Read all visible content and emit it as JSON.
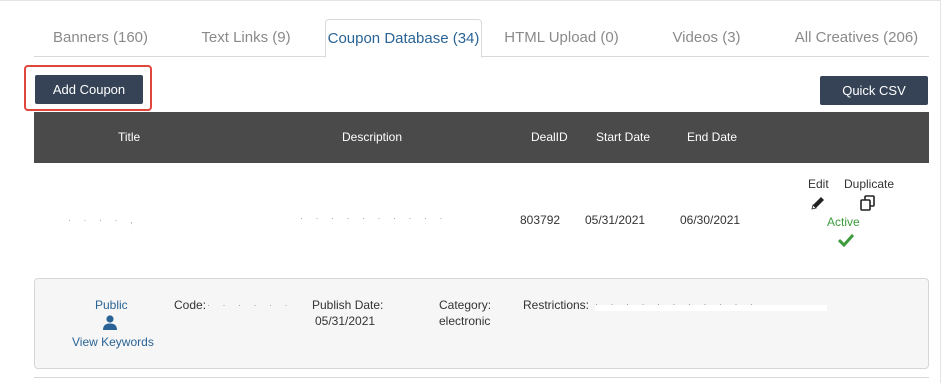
{
  "tabs": [
    {
      "label": "Banners (160)"
    },
    {
      "label": "Text Links (9)"
    },
    {
      "label": "Coupon Database (34)"
    },
    {
      "label": "HTML Upload (0)"
    },
    {
      "label": "Videos (3)"
    },
    {
      "label": "All Creatives (206)"
    }
  ],
  "active_tab": "Coupon Database (34)",
  "toolbar": {
    "add_label": "Add Coupon",
    "csv_label": "Quick CSV"
  },
  "table": {
    "headers": {
      "title": "Title",
      "description": "Description",
      "deal_id": "DealID",
      "start_date": "Start Date",
      "end_date": "End Date"
    },
    "row": {
      "deal_id": "803792",
      "start_date": "05/31/2021",
      "end_date": "06/30/2021",
      "edit_label": "Edit",
      "duplicate_label": "Duplicate",
      "status": "Active"
    }
  },
  "details": {
    "visibility": "Public",
    "keywords_link": "View Keywords",
    "code_label": "Code:",
    "publish_label": "Publish Date:",
    "publish_value": "05/31/2021",
    "category_label": "Category:",
    "category_value": "electronic",
    "restrictions_label": "Restrictions:"
  },
  "colors": {
    "accent": "#2a6496",
    "button": "#364357",
    "header": "#4a4a4a",
    "active": "#3c9b3c",
    "highlight": "#e0463a"
  },
  "icons": {
    "edit": "pencil-icon",
    "duplicate": "copy-icon",
    "status": "checkmark-icon",
    "visibility": "user-icon"
  }
}
